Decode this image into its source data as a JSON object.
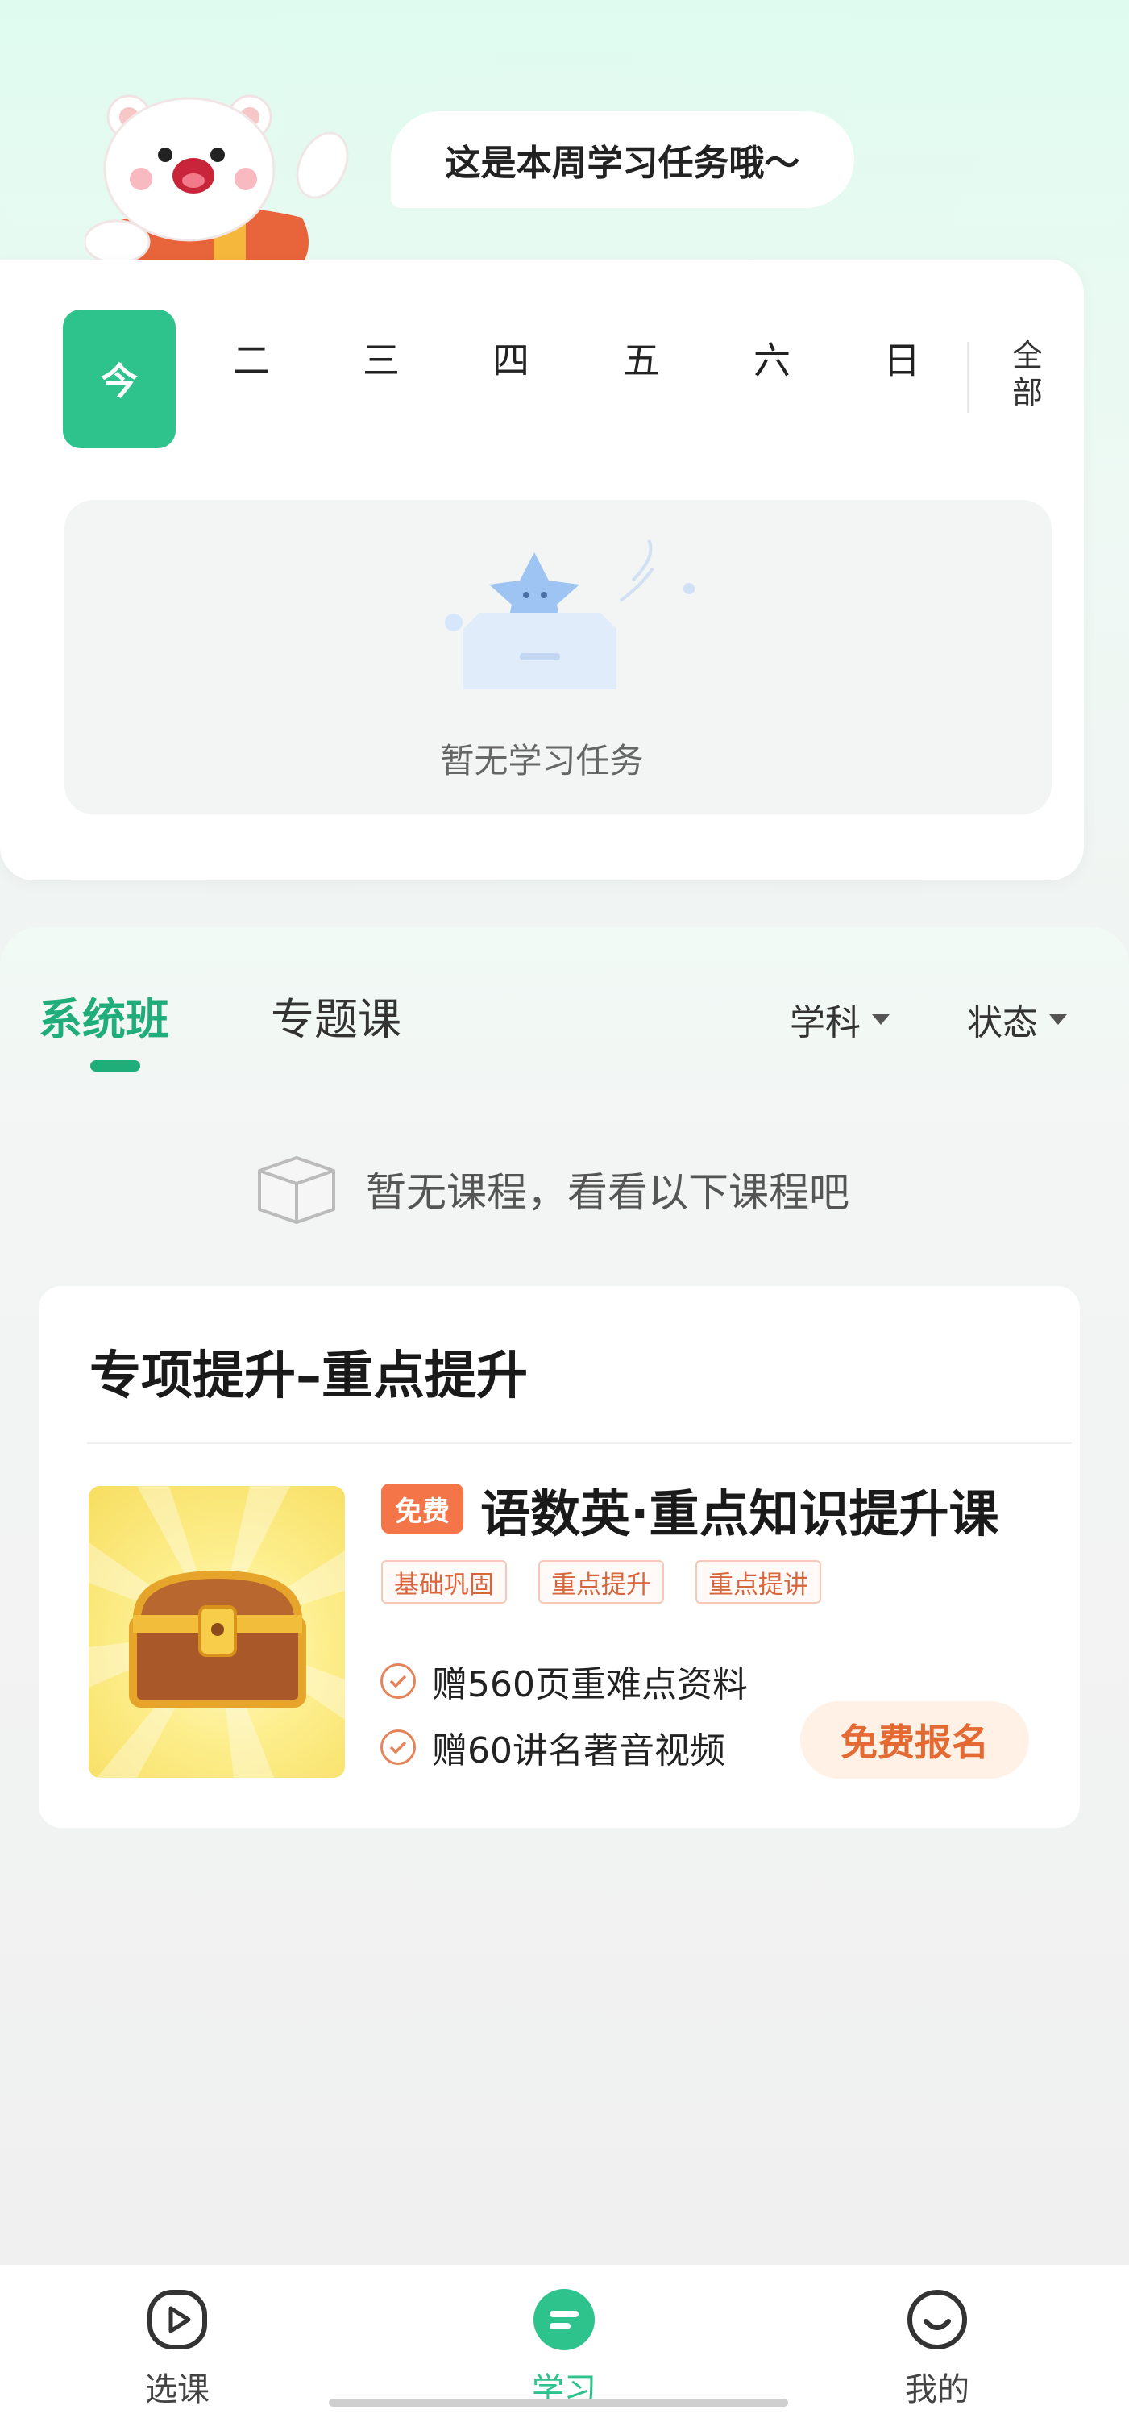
{
  "header": {
    "bubble_text": "这是本周学习任务哦～"
  },
  "week": {
    "days": [
      "今",
      "二",
      "三",
      "四",
      "五",
      "六",
      "日"
    ],
    "selected_index": 0,
    "all_label_line1": "全",
    "all_label_line2": "部",
    "empty_text": "暂无学习任务"
  },
  "courses": {
    "tabs": [
      "系统班",
      "专题课"
    ],
    "active_tab": 0,
    "filters": [
      "学科",
      "状态"
    ],
    "empty_text": "暂无课程，看看以下课程吧"
  },
  "promo": {
    "section_title": "专项提升–重点提升",
    "badge": "免费",
    "course_name": "语数英·重点知识提升课",
    "tags": [
      "基础巩固",
      "重点提升",
      "重点提讲"
    ],
    "perks": [
      "赠560页重难点资料",
      "赠60讲名著音视频"
    ],
    "enroll_label": "免费报名"
  },
  "tabbar": {
    "items": [
      "选课",
      "学习",
      "我的"
    ],
    "active": 1
  },
  "colors": {
    "brand_green": "#2ec38c",
    "accent_orange": "#f47548"
  }
}
